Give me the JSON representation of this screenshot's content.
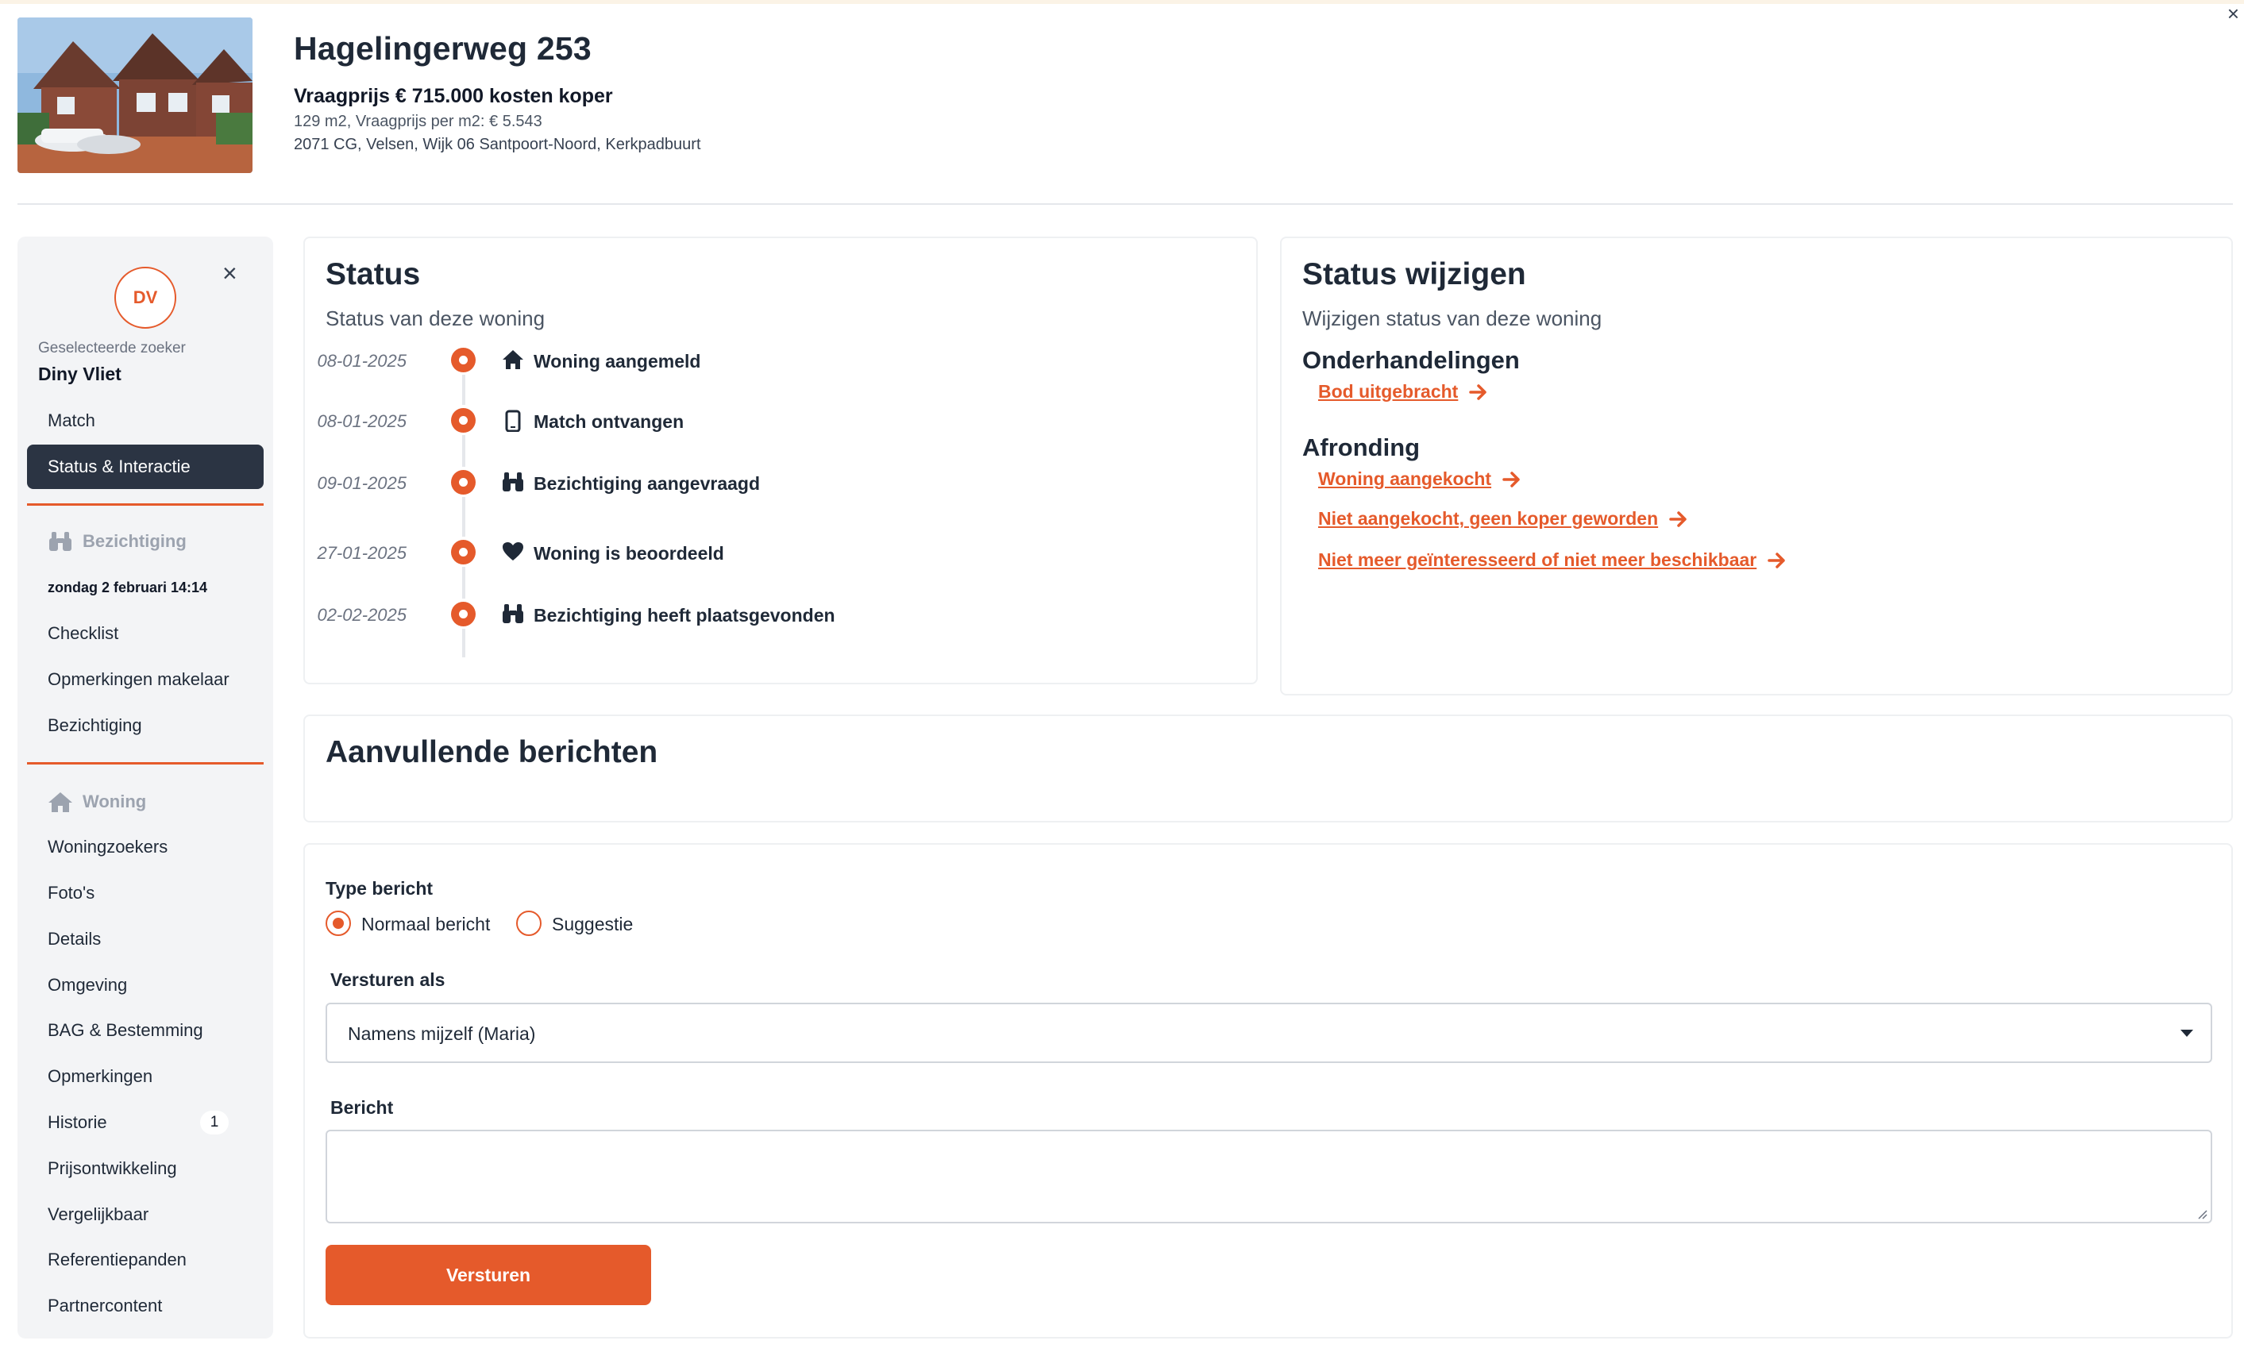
{
  "listing": {
    "title": "Hagelingerweg 253",
    "price_line": "Vraagprijs € 715.000 kosten koper",
    "meta_line": "129 m2, Vraagprijs per m2: € 5.543",
    "address_line": "2071 CG, Velsen, Wijk 06 Santpoort-Noord, Kerkpadbuurt"
  },
  "sidebar": {
    "avatar_initials": "DV",
    "selected_label": "Geselecteerde zoeker",
    "selected_name": "Diny Vliet",
    "top_items": [
      {
        "label": "Match"
      },
      {
        "label": "Status & Interactie",
        "active": true
      }
    ],
    "viewing_section": {
      "title": "Bezichtiging",
      "date": "zondag 2 februari 14:14",
      "items": [
        {
          "label": "Checklist"
        },
        {
          "label": "Opmerkingen makelaar"
        },
        {
          "label": "Bezichtiging"
        }
      ]
    },
    "home_section": {
      "title": "Woning",
      "items": [
        {
          "label": "Woningzoekers"
        },
        {
          "label": "Foto's"
        },
        {
          "label": "Details"
        },
        {
          "label": "Omgeving"
        },
        {
          "label": "BAG & Bestemming"
        },
        {
          "label": "Opmerkingen"
        },
        {
          "label": "Historie",
          "badge": "1"
        },
        {
          "label": "Prijsontwikkeling"
        },
        {
          "label": "Vergelijkbaar"
        },
        {
          "label": "Referentiepanden"
        },
        {
          "label": "Partnercontent"
        }
      ]
    }
  },
  "status": {
    "title": "Status",
    "subtitle": "Status van deze woning",
    "timeline": [
      {
        "date": "08-01-2025",
        "icon": "house-icon",
        "label": "Woning aangemeld"
      },
      {
        "date": "08-01-2025",
        "icon": "phone-icon",
        "label": "Match ontvangen"
      },
      {
        "date": "09-01-2025",
        "icon": "binoculars-icon",
        "label": "Bezichtiging aangevraagd"
      },
      {
        "date": "27-01-2025",
        "icon": "heart-icon",
        "label": "Woning is beoordeeld"
      },
      {
        "date": "02-02-2025",
        "icon": "binoculars-icon",
        "label": "Bezichtiging heeft plaatsgevonden"
      }
    ]
  },
  "status_change": {
    "title": "Status wijzigen",
    "subtitle": "Wijzigen status van deze woning",
    "groups": [
      {
        "title": "Onderhandelingen",
        "actions": [
          "Bod uitgebracht"
        ]
      },
      {
        "title": "Afronding",
        "actions": [
          "Woning aangekocht",
          "Niet aangekocht, geen koper geworden",
          "Niet meer geïnteresseerd of niet meer beschikbaar"
        ]
      }
    ]
  },
  "messages": {
    "title": "Aanvullende berichten"
  },
  "form": {
    "type_label": "Type bericht",
    "type_options": [
      {
        "label": "Normaal bericht",
        "checked": true
      },
      {
        "label": "Suggestie",
        "checked": false
      }
    ],
    "send_as_label": "Versturen als",
    "send_as_value": "Namens mijzelf (Maria)",
    "message_label": "Bericht",
    "message_value": "",
    "submit_label": "Versturen"
  },
  "colors": {
    "accent": "#e55a2b",
    "nav_active": "#2b3443",
    "sidebar_bg": "#f3f4f6"
  }
}
